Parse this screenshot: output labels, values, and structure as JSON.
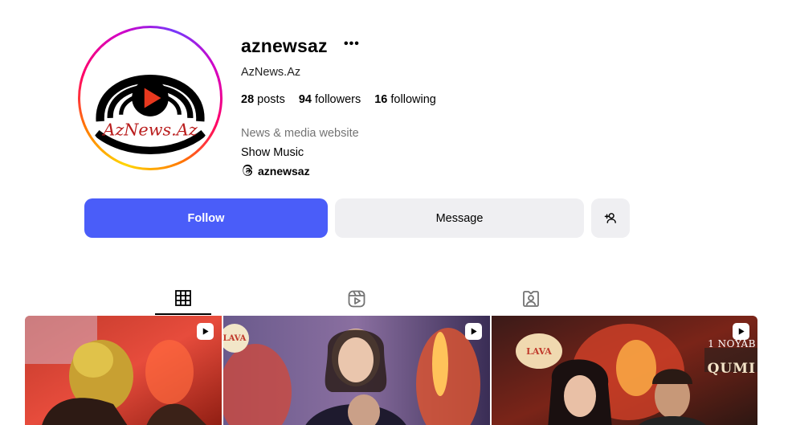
{
  "profile": {
    "username": "aznewsaz",
    "full_name": "AzNews.Az",
    "avatar_text": "AzNews.Az",
    "category": "News & media website",
    "bio": "Show Music",
    "threads_handle": "aznewsaz"
  },
  "stats": {
    "posts_count": "28",
    "posts_label": "posts",
    "followers_count": "94",
    "followers_label": "followers",
    "following_count": "16",
    "following_label": "following"
  },
  "actions": {
    "follow_label": "Follow",
    "message_label": "Message"
  },
  "icons": {
    "more": "more-icon",
    "threads": "threads-icon",
    "add_user": "add-user-icon",
    "grid_tab": "grid-icon",
    "reels_tab": "reels-icon",
    "tagged_tab": "tagged-icon",
    "reel_badge": "reel-icon"
  },
  "colors": {
    "follow_button": "#4a5df9",
    "secondary_button": "#efeff2",
    "category_text": "#737373"
  },
  "posts": [
    {
      "type": "reel",
      "overlay_text": ""
    },
    {
      "type": "reel",
      "overlay_text": "LAVA"
    },
    {
      "type": "reel",
      "overlay_text": "1 NOYAB QUMI"
    }
  ],
  "post_overlays": {
    "lava_logo": "LAVA",
    "noyab": "1 NOYAB",
    "qumi": "QUMI"
  }
}
